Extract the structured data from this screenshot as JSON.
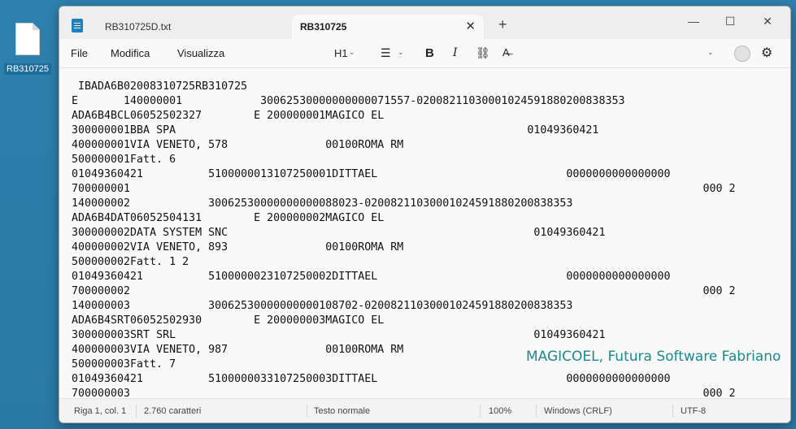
{
  "desktop": {
    "icon_label": "RB310725"
  },
  "tabs": [
    {
      "label": "RB310725D.txt"
    },
    {
      "label": "RB310725"
    }
  ],
  "titlebar": {
    "new_tab": "+",
    "minimize": "—",
    "maximize": "☐",
    "close": "✕",
    "tab_close": "✕"
  },
  "menu": {
    "file": "File",
    "edit": "Modifica",
    "view": "Visualizza"
  },
  "toolbar": {
    "heading": "H1",
    "bold": "B",
    "italic": "I"
  },
  "editor": {
    "lines": [
      " IBADA6B02008310725RB310725",
      "E       140000001            30062530000000000071557-02008211030001024591880200838353",
      "ADA6B4BCL06052502327        E 200000001MAGICO EL",
      "300000001BBA SPA                                                      01049360421",
      "400000001VIA VENETO, 578               00100ROMA RM",
      "500000001Fatt. 6",
      "01049360421          5100000013107250001DITTAEL                             0000000000000000",
      "700000001                                                                                        000 2",
      "140000002            30062530000000000088023-02008211030001024591880200838353",
      "ADA6B4DAT06052504131        E 200000002MAGICO EL",
      "300000002DATA SYSTEM SNC                                               01049360421",
      "400000002VIA VENETO, 893               00100ROMA RM",
      "500000002Fatt. 1 2",
      "01049360421          5100000023107250002DITTAEL                             0000000000000000",
      "700000002                                                                                        000 2",
      "140000003            30062530000000000108702-02008211030001024591880200838353",
      "ADA6B4SRT06052502930        E 200000003MAGICO EL",
      "300000003SRT SRL                                                       01049360421",
      "400000003VIA VENETO, 987               00100ROMA RM",
      "500000003Fatt. 7",
      "01049360421          5100000033107250003DITTAEL                             0000000000000000",
      "700000003                                                                                        000 2"
    ],
    "watermark": "MAGICOEL, Futura Software Fabriano"
  },
  "status": {
    "position": "Riga 1, col. 1",
    "chars": "2.760 caratteri",
    "format": "Testo normale",
    "zoom": "100%",
    "line_ending": "Windows (CRLF)",
    "encoding": "UTF-8"
  }
}
